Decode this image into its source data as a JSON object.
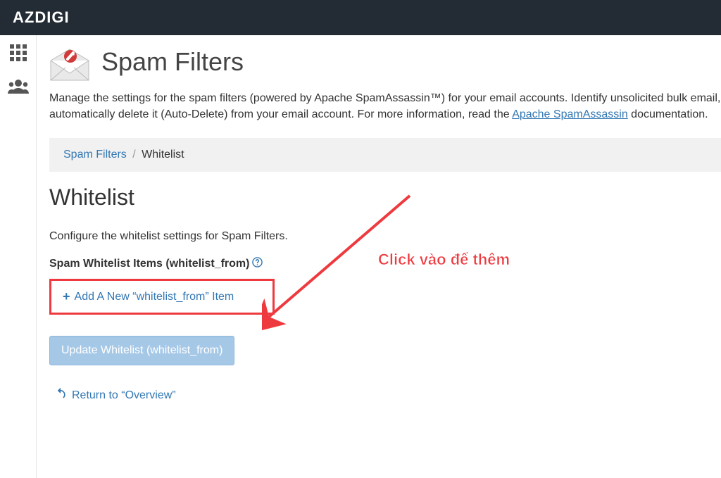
{
  "header": {
    "brand": "AZDIGI"
  },
  "page": {
    "title": "Spam Filters",
    "breadcrumb_parent": "Spam Filters",
    "breadcrumb_current": "Whitelist",
    "section_title": "Whitelist",
    "manage_pre": "Manage the settings for the spam filters (powered by Apache SpamAssassin™) for your email accounts. Identify unsolicited bulk email, automatically delete it (Auto-Delete) from your email account. For more information, read the ",
    "manage_link": "Apache SpamAssassin",
    "manage_post": " documentation.",
    "section_desc": "Configure the whitelist settings for Spam Filters.",
    "items_label": "Spam Whitelist Items (whitelist_from)",
    "add_item_label": "Add A New “whitelist_from” Item",
    "update_button": "Update Whitelist (whitelist_from)",
    "return_label": "Return to “Overview”"
  },
  "annotation": {
    "text": "Click vào để thêm"
  }
}
